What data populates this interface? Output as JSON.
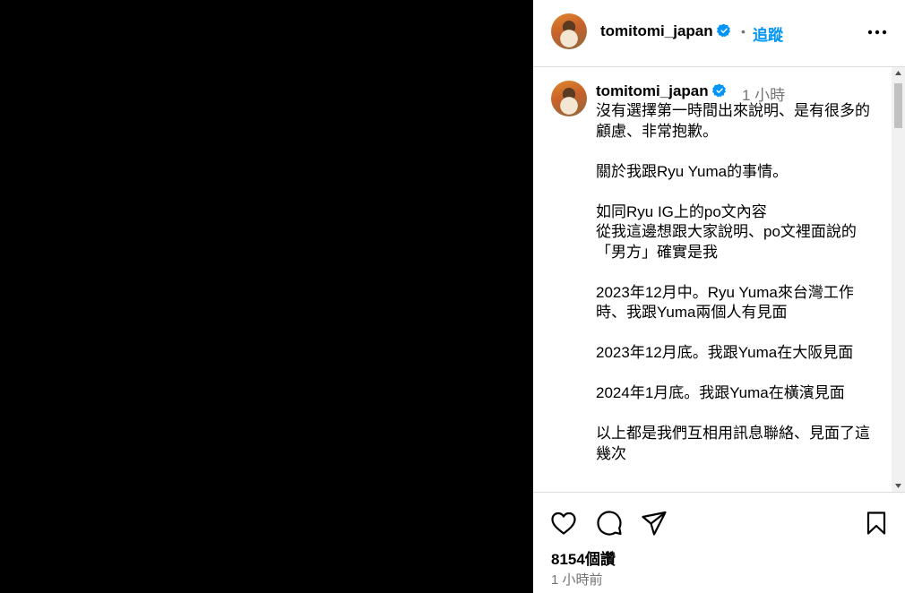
{
  "header": {
    "username": "tomitomi_japan",
    "separator": "•",
    "follow_label": "追蹤",
    "more_icon": "more-horizontal-icon",
    "verified_icon": "verified-badge-icon"
  },
  "caption": {
    "username": "tomitomi_japan",
    "time": "1 小時",
    "paragraphs": [
      "沒有選擇第一時間出來說明、是有很多的顧慮、非常抱歉。",
      "關於我跟Ryu Yuma的事情。",
      "如同Ryu IG上的po文內容\n從我這邊想跟大家說明、po文裡面說的「男方」確實是我",
      "2023年12月中。Ryu Yuma來台灣工作時、我跟Yuma兩個人有見面",
      "2023年12月底。我跟Yuma在大阪見面",
      "2024年1月底。我跟Yuma在橫濱見面",
      "以上都是我們互相用訊息聯絡、見面了這幾次"
    ]
  },
  "actions": {
    "like_icon": "heart-icon",
    "comment_icon": "comment-icon",
    "share_icon": "send-icon",
    "save_icon": "bookmark-icon"
  },
  "stats": {
    "likes": "8154個讚",
    "posted_time": "1 小時前"
  },
  "colors": {
    "link_blue": "#0095f6",
    "verified_blue": "#0095f6",
    "muted_text": "#737373",
    "divider": "#dbdbdb"
  }
}
